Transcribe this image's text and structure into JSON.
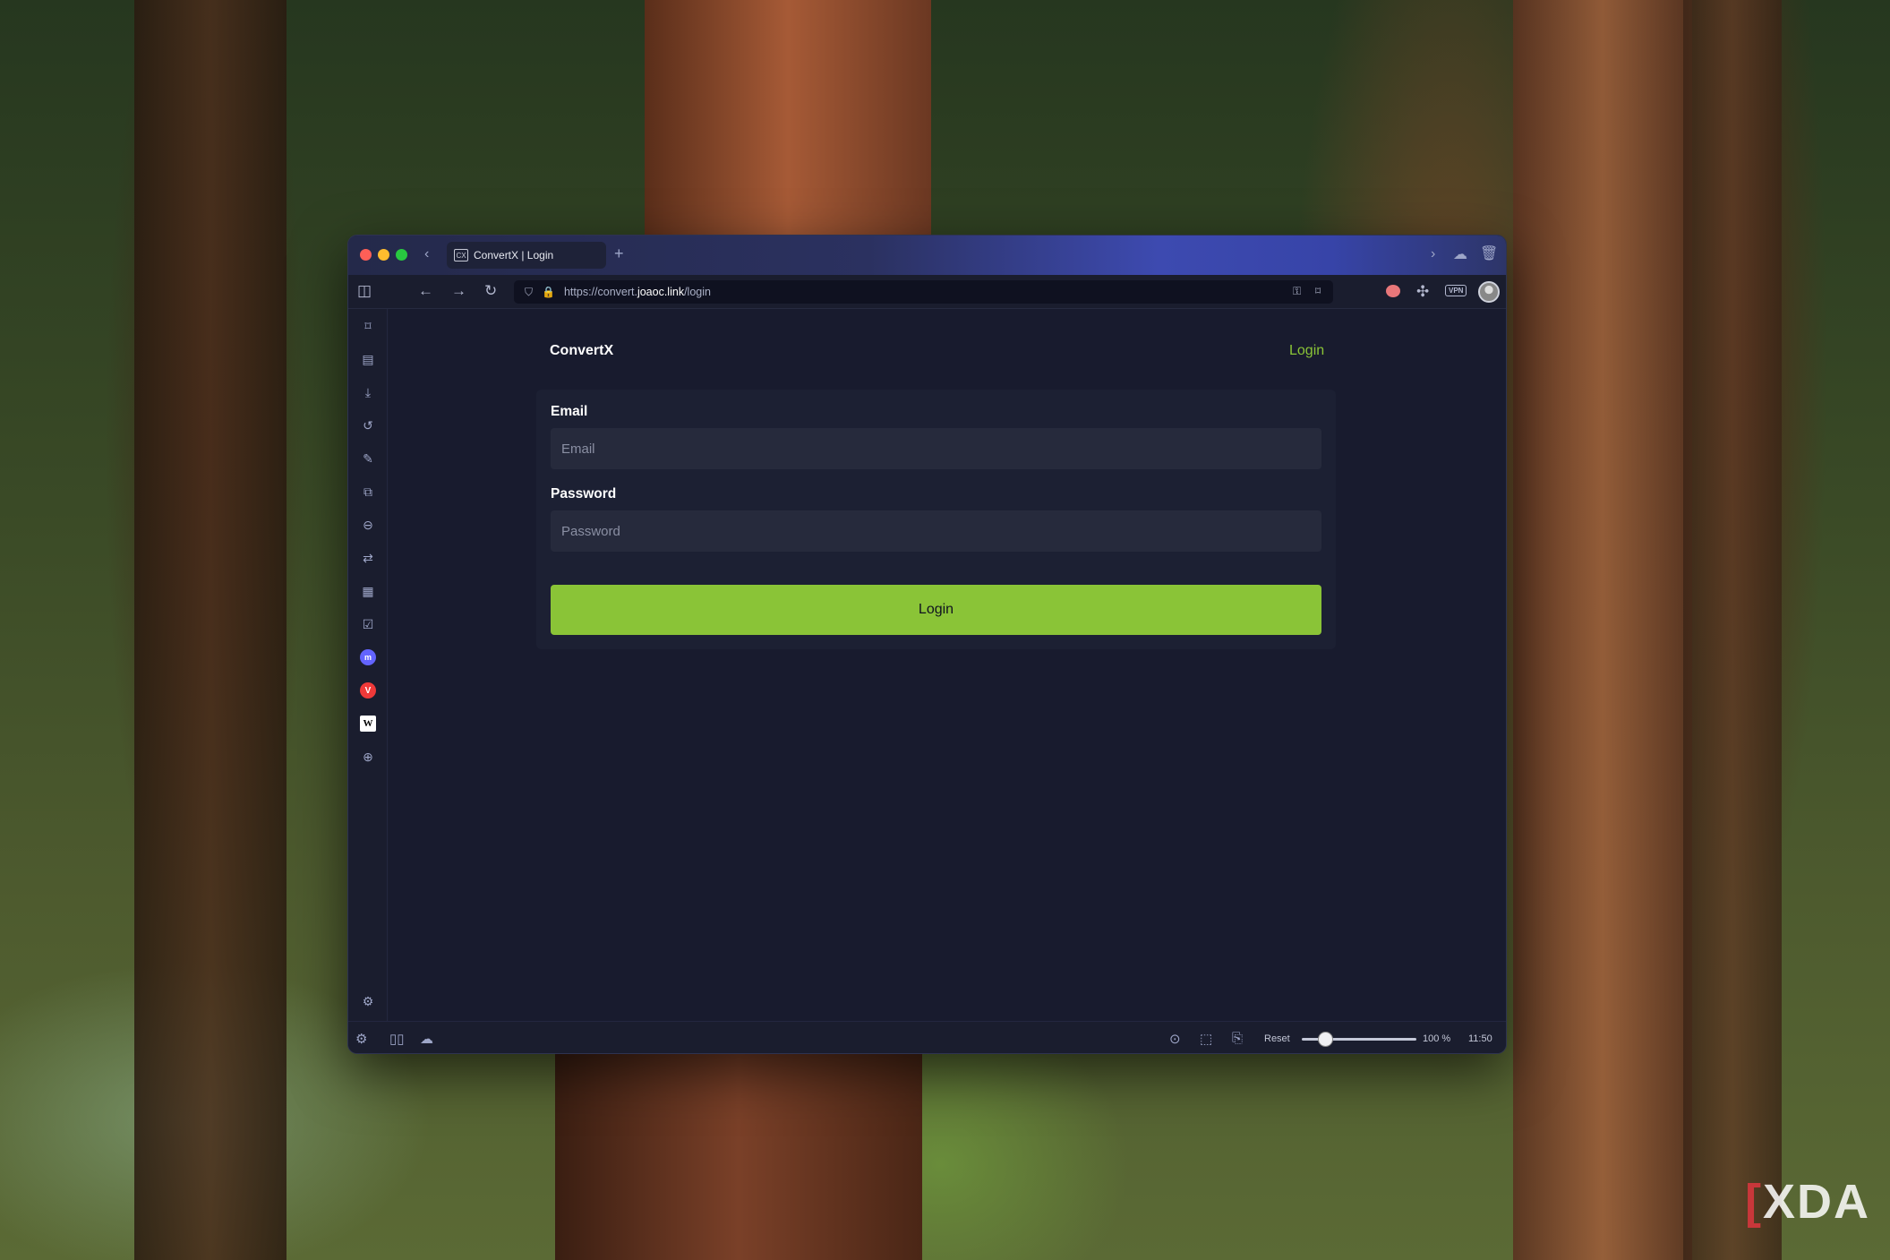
{
  "browser": {
    "tab_title": "ConvertX | Login",
    "tab_favicon": "CX",
    "new_tab": "+",
    "url_prefix": "https://convert.",
    "url_host": "joaoc.link",
    "url_path": "/login",
    "vpn_label": "VPN"
  },
  "page": {
    "brand": "ConvertX",
    "nav_login": "Login",
    "form": {
      "email_label": "Email",
      "email_placeholder": "Email",
      "password_label": "Password",
      "password_placeholder": "Password",
      "submit_label": "Login"
    }
  },
  "statusbar": {
    "reset_label": "Reset",
    "zoom_label": "100 %",
    "zoom_fraction": 0.15,
    "clock": "11:50"
  },
  "watermark": {
    "bracket": "[",
    "text": "XDA"
  },
  "colors": {
    "accent": "#8ac437",
    "window_bg": "#181b2e",
    "field_bg": "#262a3c"
  }
}
